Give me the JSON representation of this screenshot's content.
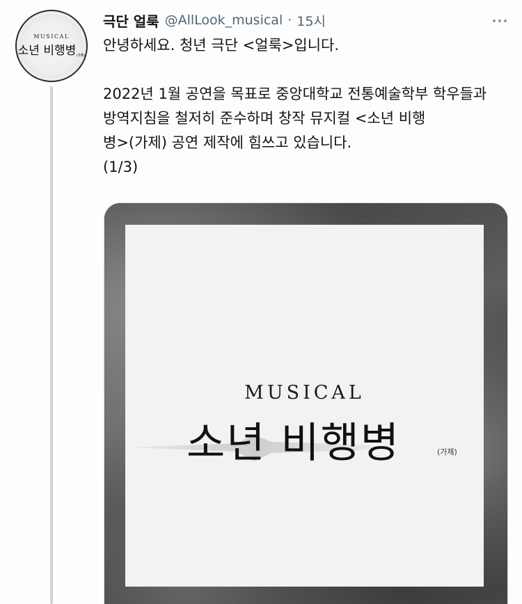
{
  "account": {
    "display_name": "극단 얼룩",
    "handle": "@AllLook_musical",
    "separator": "·",
    "time": "15시"
  },
  "avatar": {
    "musical_label": "MUSICAL",
    "title": "소년 비행병",
    "sub": "(가제)"
  },
  "tweet": {
    "line1": "안녕하세요. 청년 극단 <얼룩>입니다.",
    "line2": "2022년 1월 공연을 목표로 중앙대학교 전통예술학부 학우들과",
    "line3": "방역지침을 철저히 준수하며 창작 뮤지컬 <소년 비행",
    "line4": "병>(가제) 공연 제작에 힘쓰고 있습니다.",
    "line5": "(1/3)"
  },
  "poster": {
    "musical_label": "MUSICAL",
    "title": "소년 비행병",
    "sub": "(가제)"
  },
  "icons": {
    "more": "more-horizontal-icon"
  }
}
